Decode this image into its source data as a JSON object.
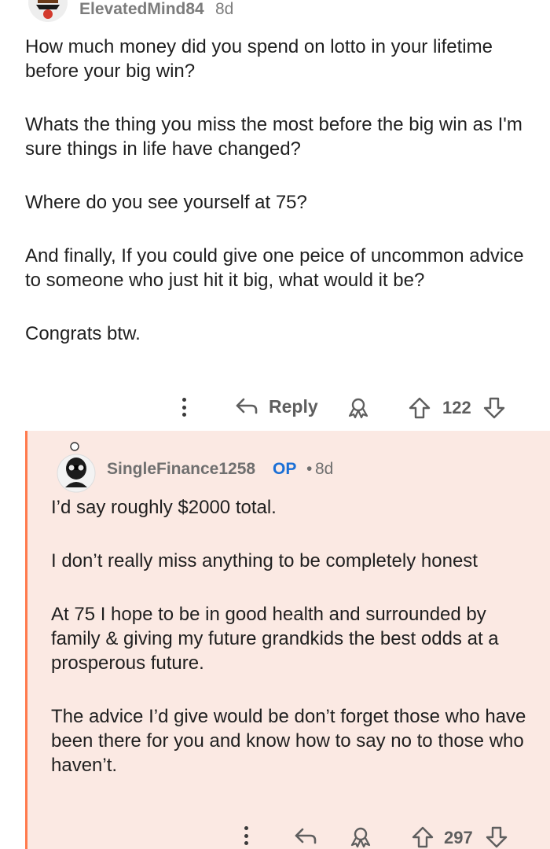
{
  "parent": {
    "username": "ElevatedMind84",
    "age": "8d",
    "paragraphs": [
      "How much money did you spend on lotto in your lifetime before your big win?",
      "Whats the thing you miss the most before the big win as I'm sure things in life have changed?",
      "Where do you see yourself at 75?",
      "And finally, If you could give one peice of uncommon advice to someone who just hit it big, what would it be?",
      "Congrats btw."
    ],
    "actions": {
      "reply_label": "Reply",
      "vote_count": "122"
    }
  },
  "reply": {
    "username": "SingleFinance1258",
    "op_badge": "OP",
    "separator": "•",
    "age": "8d",
    "paragraphs": [
      "I’d say roughly $2000 total.",
      "I don’t really miss anything to be completely honest",
      "At 75 I hope to be in good health and surrounded by family & giving my future grandkids the best odds at a prosperous future.",
      "The advice I’d give would be don’t forget those who have been there for you and know how to say no to those who haven’t."
    ],
    "actions": {
      "vote_count": "297"
    }
  },
  "colors": {
    "reply_background": "#fbe9e3",
    "reply_thread_line": "#ff7a4d",
    "op_badge": "#1a6fd6",
    "meta_text": "#7c7c7c"
  },
  "icons": [
    "more-icon",
    "reply-arrow-icon",
    "award-icon",
    "upvote-icon",
    "downvote-icon"
  ]
}
